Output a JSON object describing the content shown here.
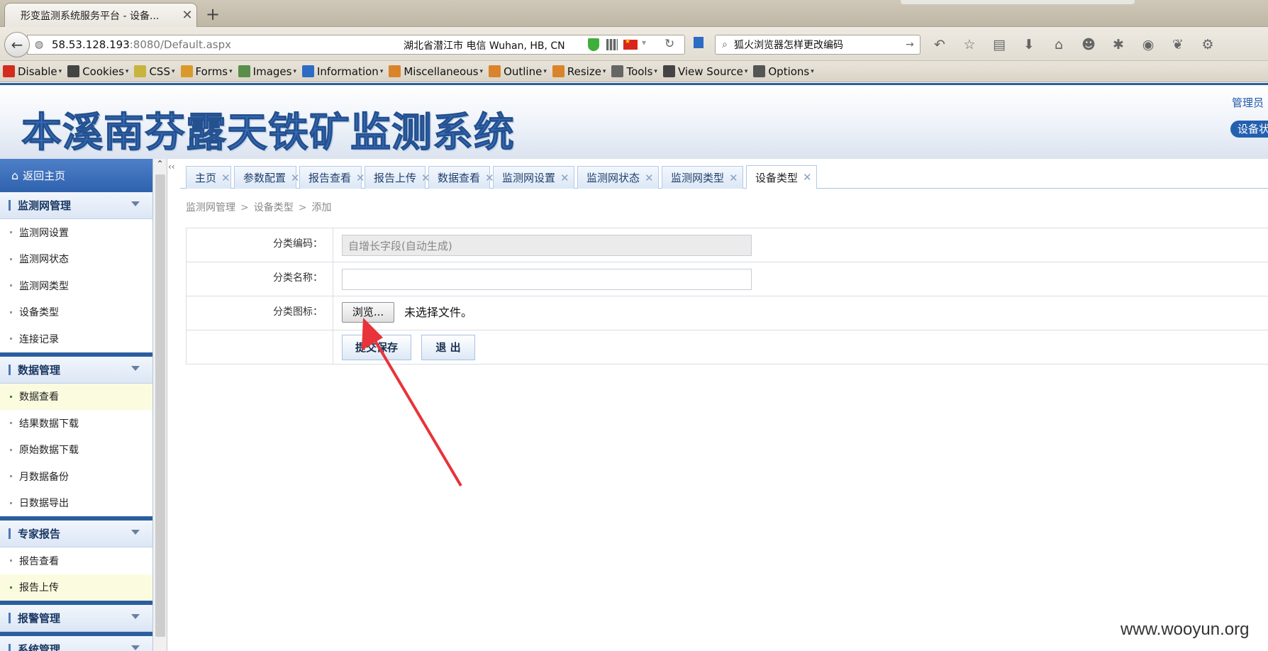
{
  "browser": {
    "tab_title": "形变监测系统服务平台 - 设备...",
    "url_host": "58.53.128.193",
    "url_path": ":8080/Default.aspx",
    "geo_info": "湖北省潜江市 电信   Wuhan, HB, CN",
    "search_text": "狐火浏览器怎样更改编码"
  },
  "devtoolbar": [
    {
      "label": "Disable",
      "icon": "disable-icon",
      "color": "#d42b1e"
    },
    {
      "label": "Cookies",
      "icon": "cookies-icon",
      "color": "#444444"
    },
    {
      "label": "CSS",
      "icon": "css-icon",
      "color": "#c7b43c"
    },
    {
      "label": "Forms",
      "icon": "forms-icon",
      "color": "#d99a2b"
    },
    {
      "label": "Images",
      "icon": "images-icon",
      "color": "#5a8f4a"
    },
    {
      "label": "Information",
      "icon": "information-icon",
      "color": "#2e6bc4"
    },
    {
      "label": "Miscellaneous",
      "icon": "miscellaneous-icon",
      "color": "#d9842b"
    },
    {
      "label": "Outline",
      "icon": "outline-icon",
      "color": "#d9842b"
    },
    {
      "label": "Resize",
      "icon": "resize-icon",
      "color": "#d9842b"
    },
    {
      "label": "Tools",
      "icon": "tools-icon",
      "color": "#666666"
    },
    {
      "label": "View Source",
      "icon": "view-source-icon",
      "color": "#444444"
    },
    {
      "label": "Options",
      "icon": "options-icon",
      "color": "#555555"
    }
  ],
  "header": {
    "title": "本溪南芬露天铁矿监测系统",
    "admin_label": "管理员",
    "status_button": "设备状"
  },
  "sidebar": {
    "home": "返回主页",
    "groups": [
      {
        "title": "监测网管理",
        "items": [
          {
            "label": "监测网设置",
            "active": false
          },
          {
            "label": "监测网状态",
            "active": false
          },
          {
            "label": "监测网类型",
            "active": false
          },
          {
            "label": "设备类型",
            "active": false
          },
          {
            "label": "连接记录",
            "active": false
          }
        ]
      },
      {
        "title": "数据管理",
        "items": [
          {
            "label": "数据查看",
            "active": true
          },
          {
            "label": "结果数据下载",
            "active": false
          },
          {
            "label": "原始数据下载",
            "active": false
          },
          {
            "label": "月数据备份",
            "active": false
          },
          {
            "label": "日数据导出",
            "active": false
          }
        ]
      },
      {
        "title": "专家报告",
        "items": [
          {
            "label": "报告查看",
            "active": false
          },
          {
            "label": "报告上传",
            "active": true
          }
        ]
      },
      {
        "title": "报警管理",
        "items": []
      },
      {
        "title": "系统管理",
        "items": []
      }
    ]
  },
  "tabs": [
    {
      "label": "主页",
      "active": false
    },
    {
      "label": "参数配置",
      "active": false
    },
    {
      "label": "报告查看",
      "active": false
    },
    {
      "label": "报告上传",
      "active": false
    },
    {
      "label": "数据查看",
      "active": false
    },
    {
      "label": "监测网设置",
      "active": false
    },
    {
      "label": "监测网状态",
      "active": false
    },
    {
      "label": "监测网类型",
      "active": false
    },
    {
      "label": "设备类型",
      "active": true
    }
  ],
  "breadcrumb": [
    "监测网管理",
    "设备类型",
    "添加"
  ],
  "form": {
    "code_label": "分类编码：",
    "code_value": "自增长字段(自动生成)",
    "name_label": "分类名称：",
    "name_value": "",
    "icon_label": "分类图标：",
    "browse_label": "浏览...",
    "no_file_text": "未选择文件。",
    "submit_label": "提交保存",
    "exit_label": "退 出"
  },
  "watermark": "www.wooyun.org",
  "colors": {
    "accent": "#2a5e9f",
    "annotation_arrow": "#e8333a"
  }
}
